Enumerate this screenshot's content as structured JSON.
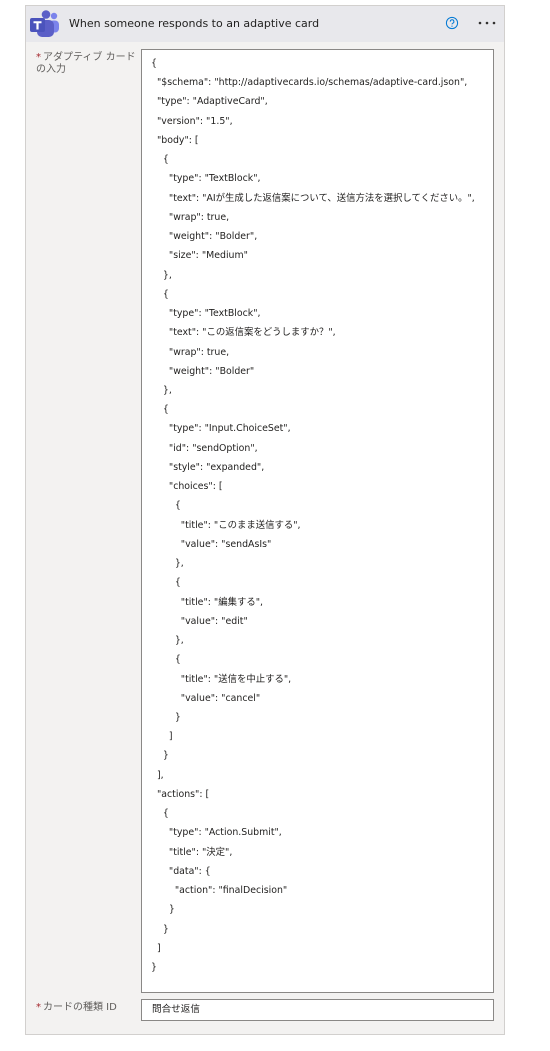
{
  "header": {
    "title": "When someone responds to an adaptive card",
    "icon": "teams-icon",
    "help_icon": "help-icon",
    "more_icon": "more-options-icon"
  },
  "fields": {
    "adaptive_card": {
      "required_mark": "*",
      "label": "アダプティブ カードの入力",
      "value": "{\n  \"$schema\": \"http://adaptivecards.io/schemas/adaptive-card.json\",\n  \"type\": \"AdaptiveCard\",\n  \"version\": \"1.5\",\n  \"body\": [\n    {\n      \"type\": \"TextBlock\",\n      \"text\": \"AIが生成した返信案について、送信方法を選択してください。\",\n      \"wrap\": true,\n      \"weight\": \"Bolder\",\n      \"size\": \"Medium\"\n    },\n    {\n      \"type\": \"TextBlock\",\n      \"text\": \"この返信案をどうしますか？\",\n      \"wrap\": true,\n      \"weight\": \"Bolder\"\n    },\n    {\n      \"type\": \"Input.ChoiceSet\",\n      \"id\": \"sendOption\",\n      \"style\": \"expanded\",\n      \"choices\": [\n        {\n          \"title\": \"このまま送信する\",\n          \"value\": \"sendAsIs\"\n        },\n        {\n          \"title\": \"編集する\",\n          \"value\": \"edit\"\n        },\n        {\n          \"title\": \"送信を中止する\",\n          \"value\": \"cancel\"\n        }\n      ]\n    }\n  ],\n  \"actions\": [\n    {\n      \"type\": \"Action.Submit\",\n      \"title\": \"決定\",\n      \"data\": {\n        \"action\": \"finalDecision\"\n      }\n    }\n  ]\n}"
    },
    "card_type_id": {
      "required_mark": "*",
      "label": "カードの種類 ID",
      "value": "問合せ返信"
    }
  },
  "colors": {
    "header_bg": "#e8e8ec",
    "panel_bg": "#f3f2f1",
    "required": "#a4262c",
    "teams_purple": "#5b5fc7",
    "help_blue": "#0078d4"
  }
}
